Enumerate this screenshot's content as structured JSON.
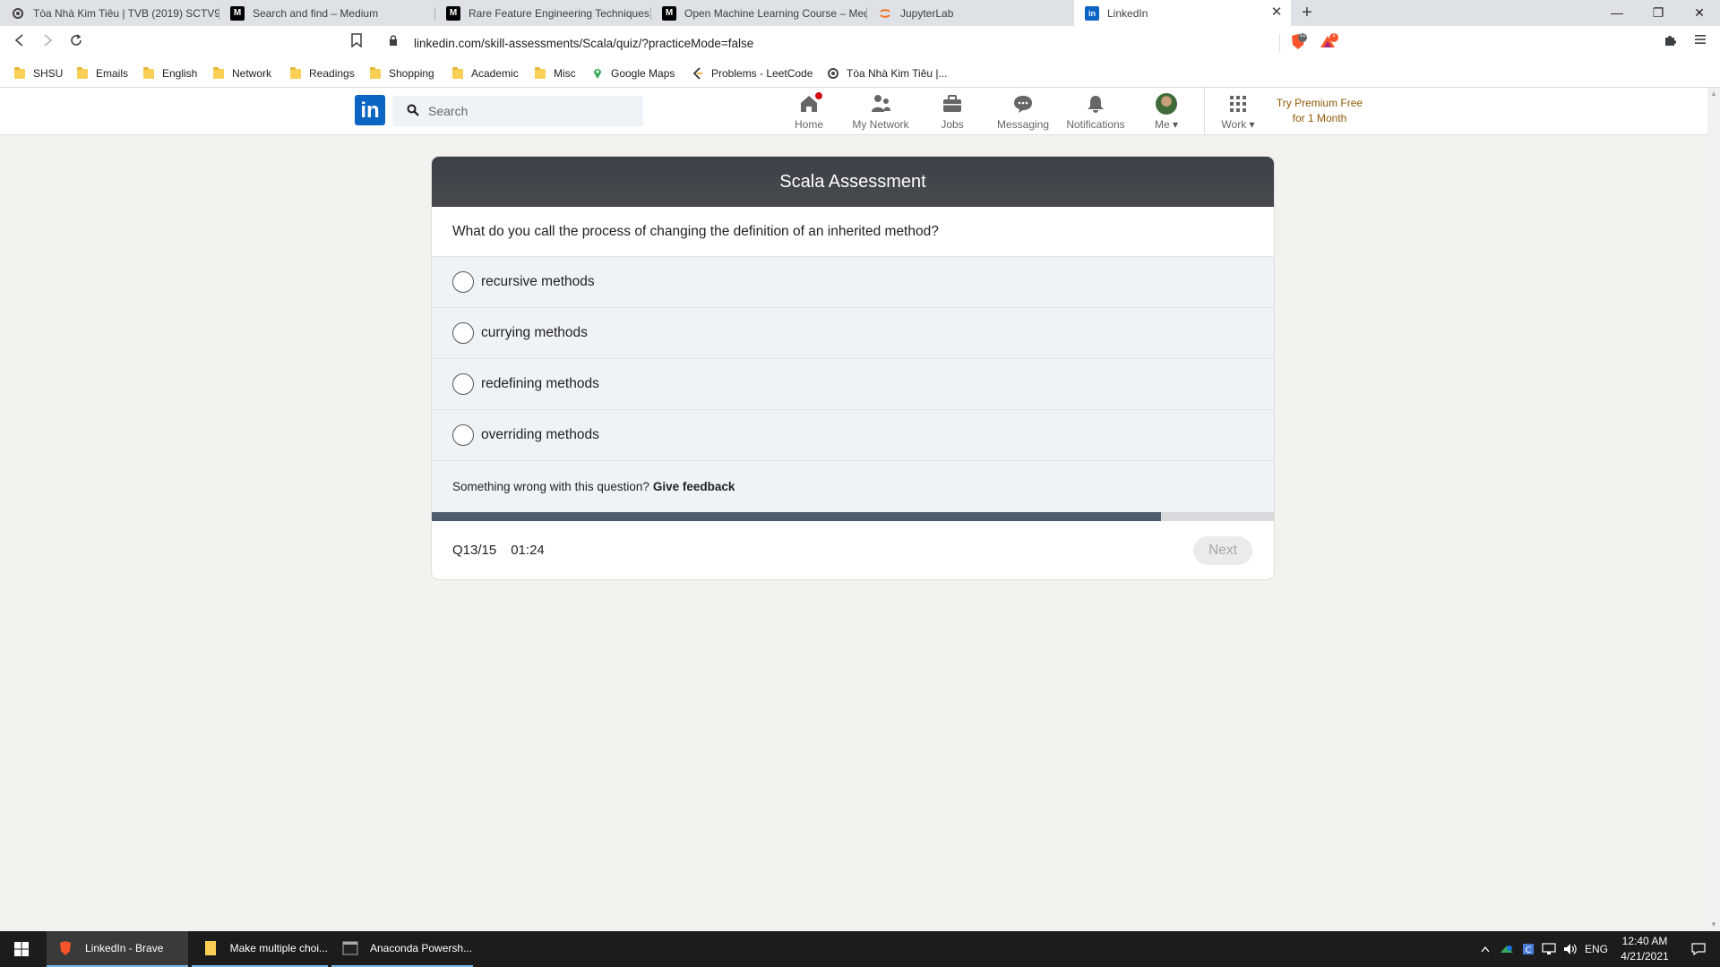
{
  "browser": {
    "tabs": [
      {
        "title": "Tòa Nhà Kim Tiêu | TVB (2019) SCTV9",
        "favicon": "tvb-favicon-icon"
      },
      {
        "title": "Search and find – Medium",
        "favicon": "medium-favicon-icon"
      },
      {
        "title": "Rare Feature Engineering Techniques",
        "favicon": "medium-favicon-icon"
      },
      {
        "title": "Open Machine Learning Course – Med",
        "favicon": "medium-favicon-icon"
      },
      {
        "title": "JupyterLab",
        "favicon": "jupyter-favicon-icon"
      },
      {
        "title": "LinkedIn",
        "favicon": "linkedin-favicon-icon",
        "active": true
      }
    ],
    "url": "linkedin.com/skill-assessments/Scala/quiz/?practiceMode=false",
    "shield_count": "11",
    "rewards_count": "1",
    "bookmarks": [
      {
        "label": "SHSU",
        "icon": "folder-icon"
      },
      {
        "label": "Emails",
        "icon": "folder-icon"
      },
      {
        "label": "English",
        "icon": "folder-icon"
      },
      {
        "label": "Network",
        "icon": "folder-icon"
      },
      {
        "label": "Readings",
        "icon": "folder-icon"
      },
      {
        "label": "Shopping",
        "icon": "folder-icon"
      },
      {
        "label": "Academic",
        "icon": "folder-icon"
      },
      {
        "label": "Misc",
        "icon": "folder-icon"
      },
      {
        "label": "Google Maps",
        "icon": "maps-pin-icon"
      },
      {
        "label": "Problems - LeetCode",
        "icon": "leetcode-icon"
      },
      {
        "label": "Tòa Nhà Kim Tiêu |...",
        "icon": "tvb-favicon-icon"
      }
    ]
  },
  "linkedin": {
    "search_placeholder": "Search",
    "nav": [
      {
        "label": "Home",
        "icon": "home-icon",
        "badge": true
      },
      {
        "label": "My Network",
        "icon": "network-icon"
      },
      {
        "label": "Jobs",
        "icon": "briefcase-icon"
      },
      {
        "label": "Messaging",
        "icon": "chat-icon"
      },
      {
        "label": "Notifications",
        "icon": "bell-icon"
      },
      {
        "label": "Me",
        "icon": "avatar"
      },
      {
        "label": "Work",
        "icon": "grid-icon"
      }
    ],
    "premium_line1": "Try Premium Free",
    "premium_line2": "for 1 Month",
    "premium_color": "#915907"
  },
  "quiz": {
    "title": "Scala Assessment",
    "question": "What do you call the process of changing the definition of an inherited method?",
    "options": [
      "recursive methods",
      "currying methods",
      "redefining methods",
      "overriding methods"
    ],
    "feedback_prompt": "Something wrong with this question?",
    "feedback_link": "Give feedback",
    "progress_fraction": 0.866,
    "question_counter": "Q13/15",
    "timer": "01:24",
    "next_label": "Next",
    "colors": {
      "header": "#3c4147",
      "option_bg": "#eef3f7",
      "progress": "#4e5d6b"
    }
  },
  "taskbar": {
    "apps": [
      {
        "label": "LinkedIn - Brave",
        "icon": "brave-icon",
        "active": true
      },
      {
        "label": "Make multiple choi...",
        "icon": "file-explorer-icon"
      },
      {
        "label": "Anaconda Powersh...",
        "icon": "terminal-icon"
      }
    ],
    "language": "ENG",
    "time": "12:40 AM",
    "date": "4/21/2021"
  }
}
